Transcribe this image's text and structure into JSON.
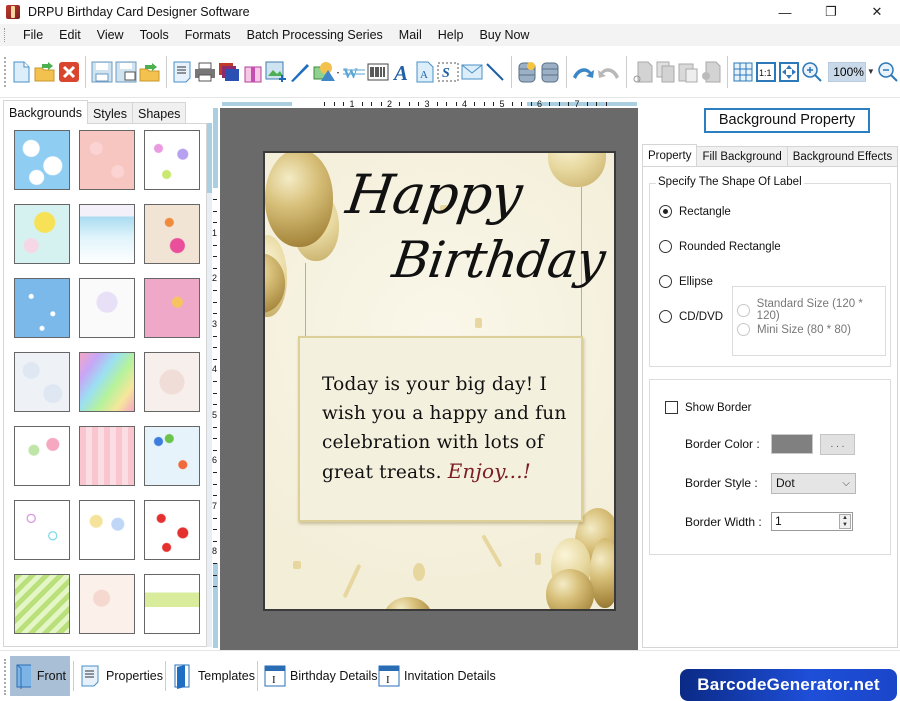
{
  "window": {
    "title": "DRPU Birthday Card Designer Software",
    "controls": {
      "minimize": "—",
      "restore": "❐",
      "close": "✕"
    }
  },
  "menu": [
    "File",
    "Edit",
    "View",
    "Tools",
    "Formats",
    "Batch Processing Series",
    "Mail",
    "Help",
    "Buy Now"
  ],
  "toolbar": {
    "groups": [
      [
        "new-icon",
        "open-icon",
        "close-icon"
      ],
      [
        "save-icon",
        "save-as-icon",
        "export-icon"
      ],
      [
        "properties-icon",
        "print-icon",
        "layers-icon",
        "gift-icon",
        "add-image-icon",
        "pen-icon",
        "shape-icon",
        "watermark-icon",
        "barcode-icon",
        "text-icon",
        "word-art-icon",
        "signature-icon",
        "mail-icon",
        "line-icon"
      ],
      [
        "database-icon",
        "database2-icon"
      ],
      [
        "undo-icon",
        "redo-icon"
      ],
      [
        "cut-icon",
        "copy-icon",
        "paste-icon",
        "delete-icon"
      ],
      [
        "grid-icon",
        "actual-size-icon",
        "fit-icon",
        "zoom-in-icon"
      ]
    ],
    "zoom_value": "100%"
  },
  "left_panel": {
    "tabs": [
      "Backgrounds",
      "Styles",
      "Shapes"
    ],
    "active_tab": "Backgrounds",
    "thumbnails": [
      "clouds",
      "pink-floral",
      "butterflies",
      "daisies",
      "cartoon-landscape",
      "balloons-bird",
      "stars-blue",
      "pastel-balloons",
      "pink-party",
      "bubbles",
      "rainbow-watercolor",
      "teddy-bear",
      "happy-birthday-text",
      "pink-hearts-stripes",
      "colorful-balloons",
      "heart-outlines",
      "balloon-bunches",
      "red-hearts",
      "green-stripes",
      "cakes-pattern",
      "confetti-meadow"
    ]
  },
  "rulers": {
    "horizontal": [
      "1",
      "2",
      "3",
      "4",
      "5",
      "6",
      "7"
    ],
    "vertical": [
      "1",
      "2",
      "3",
      "4",
      "5",
      "6",
      "7",
      "8"
    ]
  },
  "card": {
    "title_line1": "Happy",
    "title_line2": "Birthday",
    "message": "Today is your big day! I wish you a happy and fun celebration with lots of great treats.",
    "closing": "Enjoy...!"
  },
  "right_panel": {
    "header_button": "Background Property",
    "tabs": [
      "Property",
      "Fill Background",
      "Background Effects"
    ],
    "active_tab": "Property",
    "shape_group_title": "Specify The Shape Of Label",
    "shapes": [
      {
        "label": "Rectangle",
        "checked": true
      },
      {
        "label": "Rounded Rectangle",
        "checked": false
      },
      {
        "label": "Ellipse",
        "checked": false
      },
      {
        "label": "CD/DVD",
        "checked": false
      }
    ],
    "cd_sizes": [
      {
        "label": "Standard Size (120 * 120)",
        "enabled": false
      },
      {
        "label": "Mini Size (80 * 80)",
        "enabled": false
      }
    ],
    "show_border_label": "Show Border",
    "show_border": false,
    "border_color_label": "Border Color :",
    "border_color": "#808080",
    "border_color_button": ". . .",
    "border_style_label": "Border Style :",
    "border_style": "Dot",
    "border_width_label": "Border Width :",
    "border_width": "1"
  },
  "bottom_bar": {
    "items": [
      {
        "label": "Front",
        "icon": "front-page-icon",
        "active": true
      },
      {
        "label": "Properties",
        "icon": "properties-icon",
        "active": false
      },
      {
        "label": "Templates",
        "icon": "templates-icon",
        "active": false
      },
      {
        "label": "Birthday Details",
        "icon": "details-icon",
        "active": false
      },
      {
        "label": "Invitation Details",
        "icon": "details-icon",
        "active": false
      }
    ]
  },
  "brand": "BarcodeGenerator.net"
}
